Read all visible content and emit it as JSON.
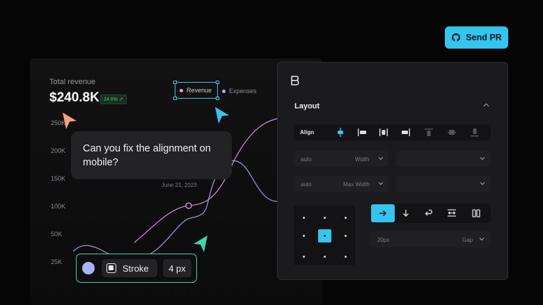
{
  "dashboard": {
    "total_label": "Total revenue",
    "total_value": "$240.8K",
    "change_badge": "24.6% ↗",
    "y_ticks": [
      "250K",
      "200K",
      "150K",
      "100K",
      "50K",
      "25K"
    ],
    "legend": {
      "revenue": "Revenue",
      "expenses": "Expenses"
    },
    "tooltip_date": "June 21, 2023",
    "colors": {
      "revenue": "#e49cf0",
      "expenses": "#a9b4f2"
    }
  },
  "comment": {
    "text": "Can you fix the alignment on mobile?"
  },
  "stroke_toolbar": {
    "label": "Stroke",
    "width": "4 px",
    "swatch_color": "#a9b4f2"
  },
  "send_pr": {
    "label": "Send PR"
  },
  "layout_panel": {
    "title": "Layout",
    "align_label": "Align",
    "width_field": {
      "value": "auto",
      "label": "Width"
    },
    "max_width_field": {
      "value": "auto",
      "label": "Max Width"
    },
    "gap_field": {
      "value": "20px",
      "label": "Gap"
    }
  },
  "colors": {
    "accent": "#35c4ee",
    "cursor_orange": "#f4a27e",
    "cursor_cyan": "#35c4ee",
    "cursor_green": "#3fd6ad"
  }
}
